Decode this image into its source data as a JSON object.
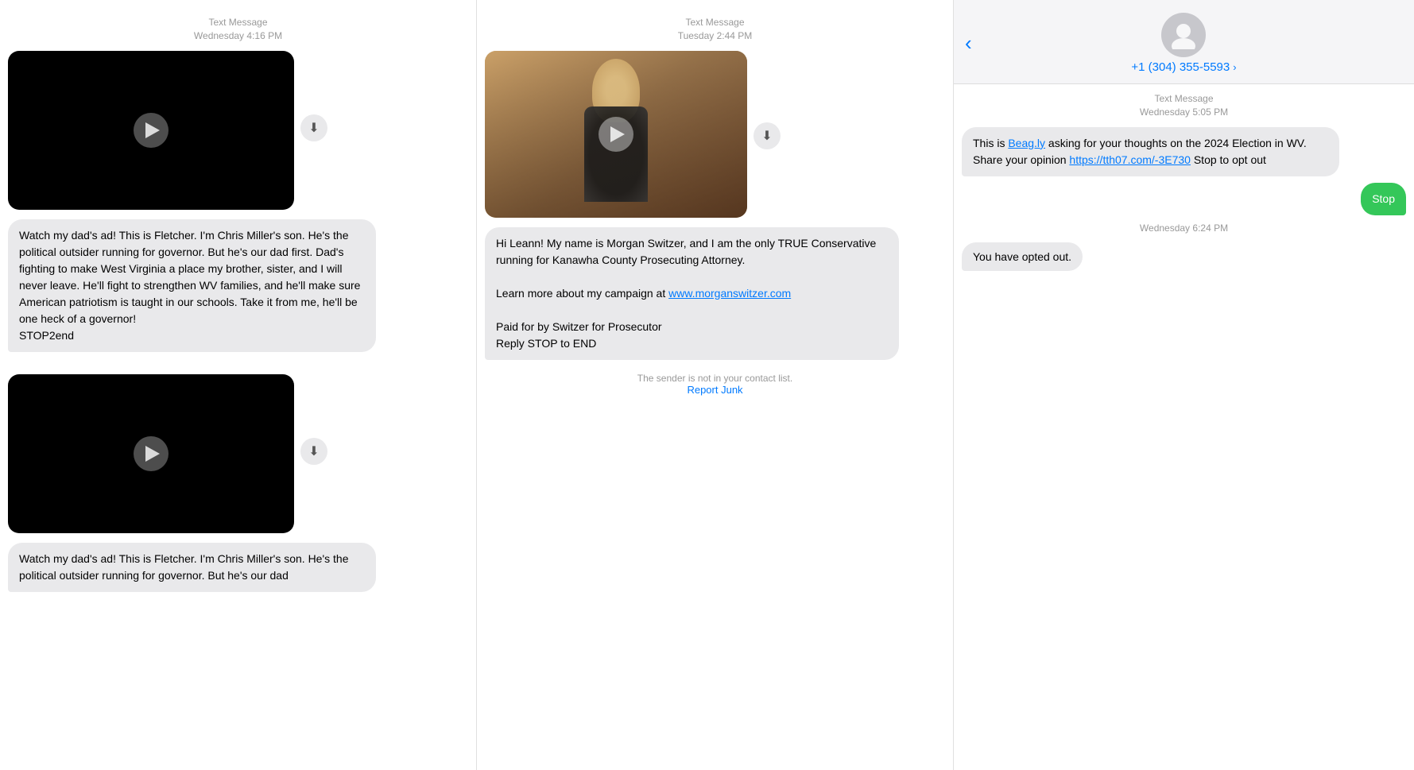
{
  "col1": {
    "header1": {
      "type": "Text Message",
      "time": "Wednesday 4:16 PM"
    },
    "msg1_text": "Watch my dad's ad! This is Fletcher. I'm Chris Miller's son. He's the political outsider running for governor. But he's our dad first. Dad's fighting to make West Virginia a place my brother, sister, and I will never leave. He'll fight to strengthen WV families, and he'll make sure American patriotism is taught in our schools. Take it from me, he'll be one heck of a governor!\nSTOP2end",
    "header2": {
      "type": "Text Message",
      "time": "Wednesday 4:16 PM"
    },
    "msg2_text": "Watch my dad's ad! This is Fletcher. I'm Chris Miller's son. He's the political outsider running for governor. But he's our dad"
  },
  "col2": {
    "header": {
      "type": "Text Message",
      "time": "Tuesday 2:44 PM"
    },
    "msg_text": "Hi Leann! My name is Morgan Switzer, and I am the only TRUE Conservative running for Kanawha County Prosecuting Attorney.\n\nLearn more about my campaign at www.morganswitzer.com\n\nPaid for by Switzer for Prosecutor\nReply STOP to END",
    "website": "www.morganswitzer.com",
    "sender_notice": "The sender is not in your contact list.",
    "report_junk": "Report Junk"
  },
  "col3": {
    "back_label": "‹",
    "phone_number": "+1 (304) 355-5593",
    "chevron": "›",
    "header": {
      "type": "Text Message",
      "time": "Wednesday 5:05 PM"
    },
    "msg1_part1": "This is ",
    "msg1_link1": "Beag.ly",
    "msg1_part2": " asking for your thoughts on the 2024 Election in WV. Share your opinion ",
    "msg1_link2": "https://tth07.com/-3E730",
    "msg1_part3": " Stop to opt out",
    "stop_label": "Stop",
    "time2": "Wednesday 6:24 PM",
    "opted_out": "You have opted out."
  },
  "icons": {
    "back": "‹",
    "chevron_right": "›",
    "person": "👤",
    "download": "⬇",
    "play": "▶"
  }
}
